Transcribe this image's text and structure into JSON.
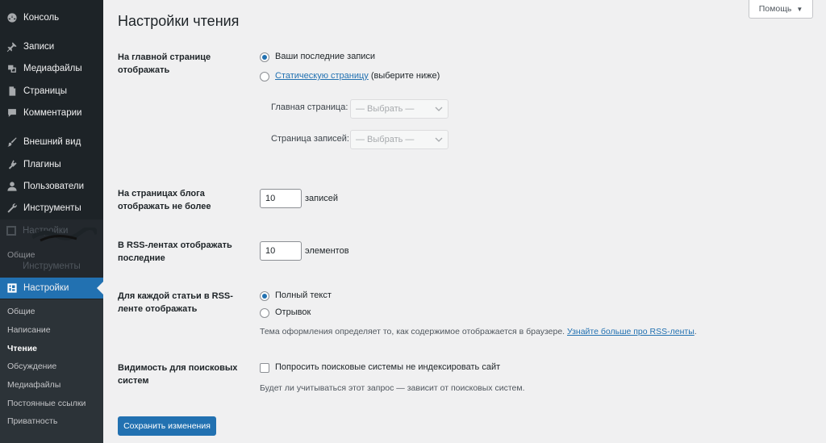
{
  "sidebar": {
    "items": [
      {
        "label": "Консоль",
        "icon": "dashboard-icon"
      },
      {
        "label": "Записи",
        "icon": "pin-icon"
      },
      {
        "label": "Медиафайлы",
        "icon": "media-icon"
      },
      {
        "label": "Страницы",
        "icon": "pages-icon"
      },
      {
        "label": "Комментарии",
        "icon": "comments-icon"
      },
      {
        "label": "Внешний вид",
        "icon": "brush-icon"
      },
      {
        "label": "Плагины",
        "icon": "plugin-icon"
      },
      {
        "label": "Пользователи",
        "icon": "users-icon"
      },
      {
        "label": "Инструменты",
        "icon": "wrench-icon"
      },
      {
        "label": "Настройки",
        "icon": "settings-icon"
      }
    ],
    "ghost": {
      "line1": "Настройки",
      "line2": "Общие",
      "line3": "Инструменты"
    },
    "submenu": [
      "Общие",
      "Написание",
      "Чтение",
      "Обсуждение",
      "Медиафайлы",
      "Постоянные ссылки",
      "Приватность"
    ],
    "active_sub": "Чтение"
  },
  "header": {
    "title": "Настройки чтения",
    "help": "Помощь"
  },
  "form": {
    "front_page": {
      "label": "На главной странице отображать",
      "option_latest": "Ваши последние записи",
      "option_static_link": "Статическую страницу",
      "option_static_suffix": " (выберите ниже)",
      "home_label": "Главная страница:",
      "posts_label": "Страница записей:",
      "select_placeholder": "— Выбрать —"
    },
    "posts_per_page": {
      "label": "На страницах блога отображать не более",
      "value": "10",
      "unit": "записей"
    },
    "rss_count": {
      "label": "В RSS-лентах отображать последние",
      "value": "10",
      "unit": "элементов"
    },
    "rss_content": {
      "label": "Для каждой статьи в RSS-ленте отображать",
      "option_full": "Полный текст",
      "option_excerpt": "Отрывок",
      "desc_text": "Тема оформления определяет то, как содержимое отображается в браузере. ",
      "desc_link": "Узнайте больше про RSS-ленты",
      "desc_end": "."
    },
    "visibility": {
      "label": "Видимость для поисковых систем",
      "checkbox_label": "Попросить поисковые системы не индексировать сайт",
      "desc": "Будет ли учитываться этот запрос — зависит от поисковых систем."
    },
    "save": "Сохранить изменения"
  },
  "colors": {
    "accent": "#2271b1",
    "sidebar": "#1d2327",
    "background": "#f0f0f1"
  }
}
